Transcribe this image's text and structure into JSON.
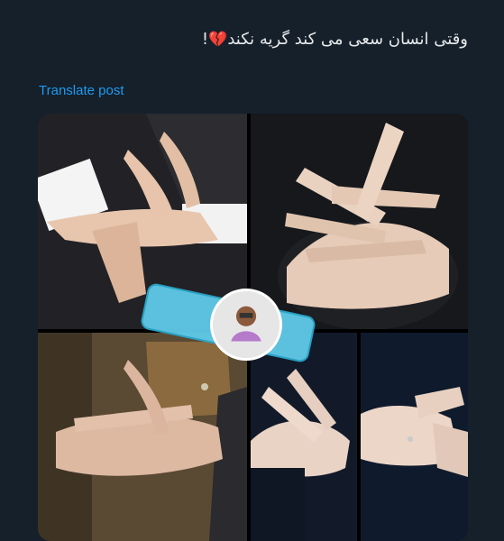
{
  "post": {
    "text": "وقتی انسان سعی می کند گریه نکند",
    "heart_emoji": "💔",
    "trailing": "!"
  },
  "translate": {
    "label": "Translate post"
  },
  "media": {
    "tile_count": 5,
    "colors": {
      "background": "#15202b",
      "link": "#1d9bf0",
      "redaction": "#5ec8e6"
    }
  }
}
